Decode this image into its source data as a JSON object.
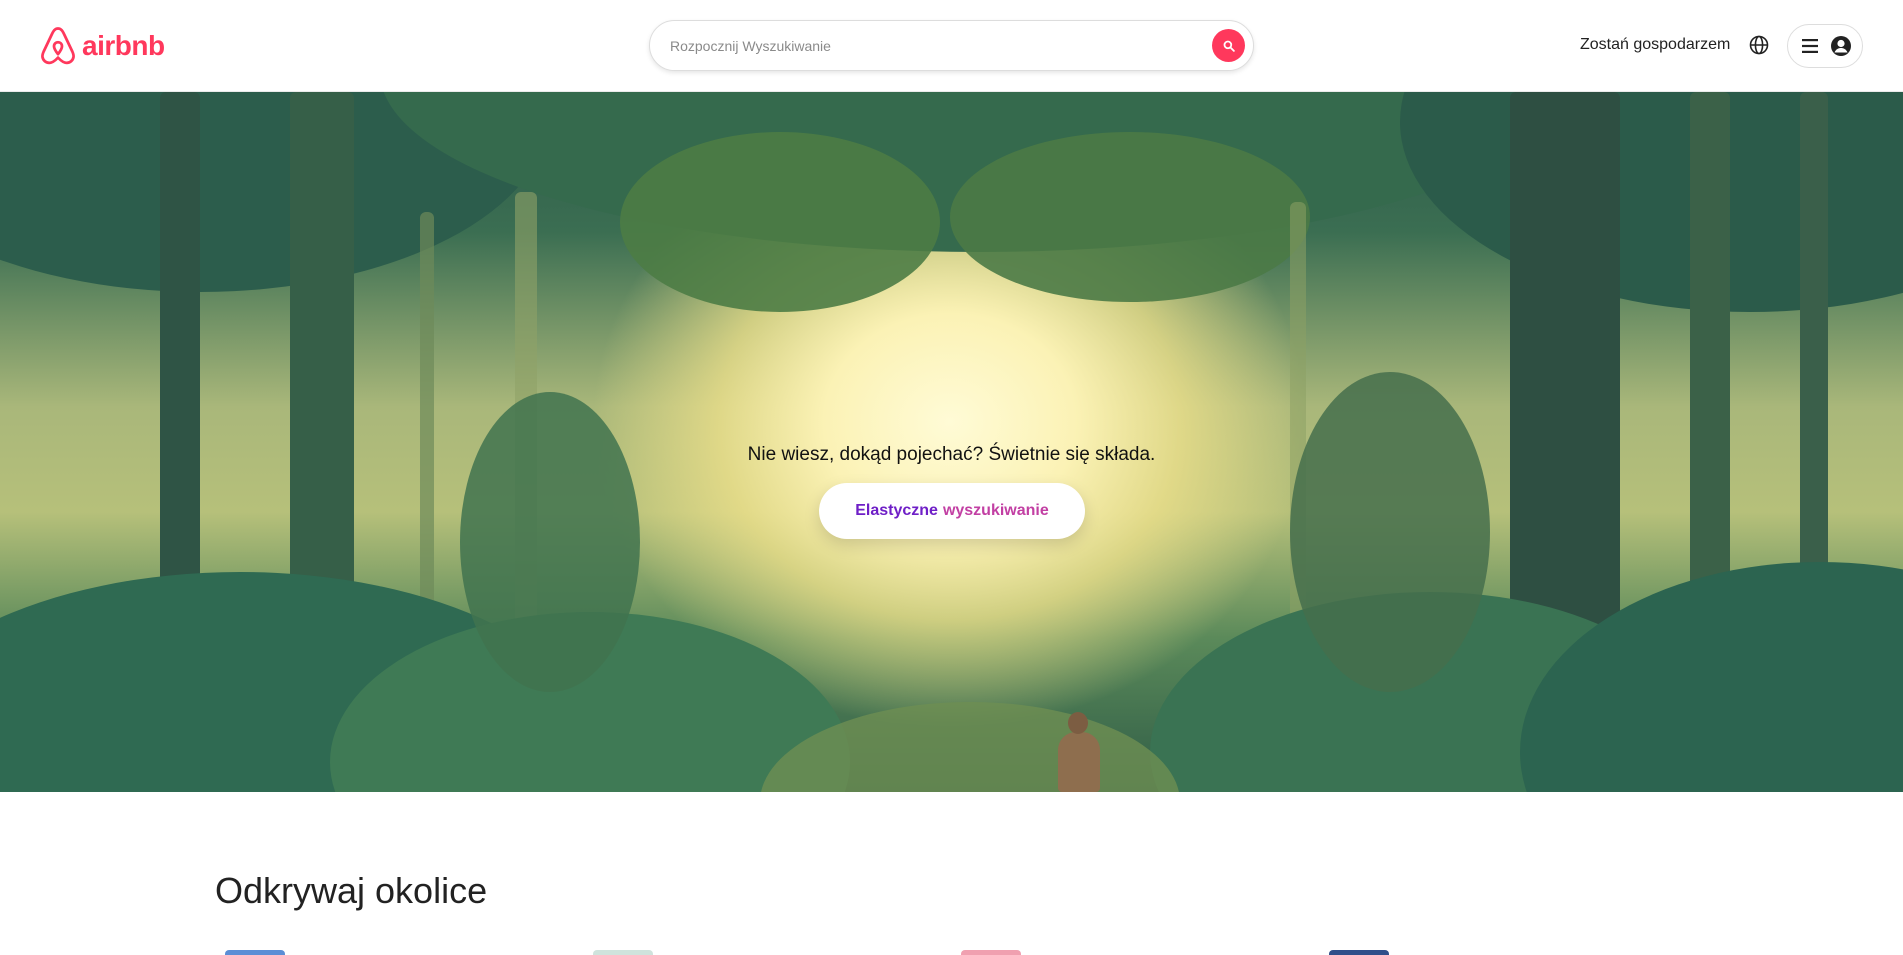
{
  "header": {
    "logo_text": "airbnb",
    "search_placeholder": "Rozpocznij Wyszukiwanie",
    "host_link": "Zostań gospodarzem",
    "icons": [
      "airbnb-logo-icon",
      "search-icon",
      "globe-icon",
      "menu-icon",
      "user-icon"
    ]
  },
  "hero": {
    "headline": "Nie wiesz, dokąd pojechać? Świetnie się składa.",
    "button_part1": "Elastyczne",
    "button_part2": "wyszukiwanie"
  },
  "section": {
    "title": "Odkrywaj okolice"
  },
  "colors": {
    "brand": "#FF385C",
    "button_purple": "#6f1fc7",
    "button_pink": "#c23fa3"
  }
}
